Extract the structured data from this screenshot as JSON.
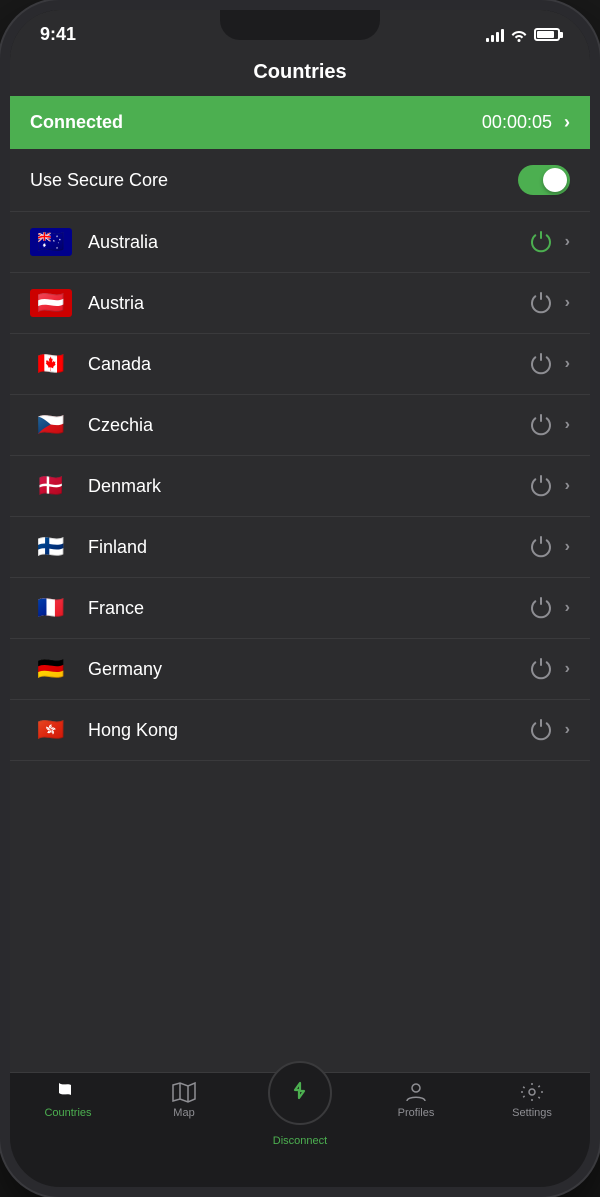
{
  "status_bar": {
    "time": "9:41",
    "signal_bars": [
      4,
      7,
      10,
      13
    ],
    "battery_level": 85
  },
  "nav": {
    "title": "Countries"
  },
  "connection": {
    "status_label": "Connected",
    "timer": "00:00:05",
    "chevron": "›"
  },
  "secure_core": {
    "label": "Use Secure Core",
    "enabled": true
  },
  "countries": [
    {
      "name": "Australia",
      "flag_class": "flag-au",
      "connected": true
    },
    {
      "name": "Austria",
      "flag_class": "flag-at",
      "connected": false
    },
    {
      "name": "Canada",
      "flag_class": "flag-ca",
      "connected": false
    },
    {
      "name": "Czechia",
      "flag_class": "flag-cz",
      "connected": false
    },
    {
      "name": "Denmark",
      "flag_class": "flag-dk",
      "connected": false
    },
    {
      "name": "Finland",
      "flag_class": "flag-fi",
      "connected": false
    },
    {
      "name": "France",
      "flag_class": "flag-fr",
      "connected": false
    },
    {
      "name": "Germany",
      "flag_class": "flag-de",
      "connected": false
    },
    {
      "name": "Hong Kong",
      "flag_class": "flag-hk",
      "connected": false
    }
  ],
  "tab_bar": {
    "items": [
      {
        "id": "countries",
        "label": "Countries",
        "icon": "flag",
        "active": true
      },
      {
        "id": "map",
        "label": "Map",
        "icon": "map",
        "active": false
      },
      {
        "id": "disconnect",
        "label": "Disconnect",
        "icon": "disconnect",
        "active": false,
        "center": true
      },
      {
        "id": "profiles",
        "label": "Profiles",
        "icon": "profile",
        "active": false
      },
      {
        "id": "settings",
        "label": "Settings",
        "icon": "gear",
        "active": false
      }
    ]
  },
  "colors": {
    "green": "#4caf50",
    "bg_dark": "#2c2c2e",
    "bg_darker": "#1c1c1e",
    "text_primary": "#ffffff",
    "text_secondary": "#8e8e93"
  }
}
